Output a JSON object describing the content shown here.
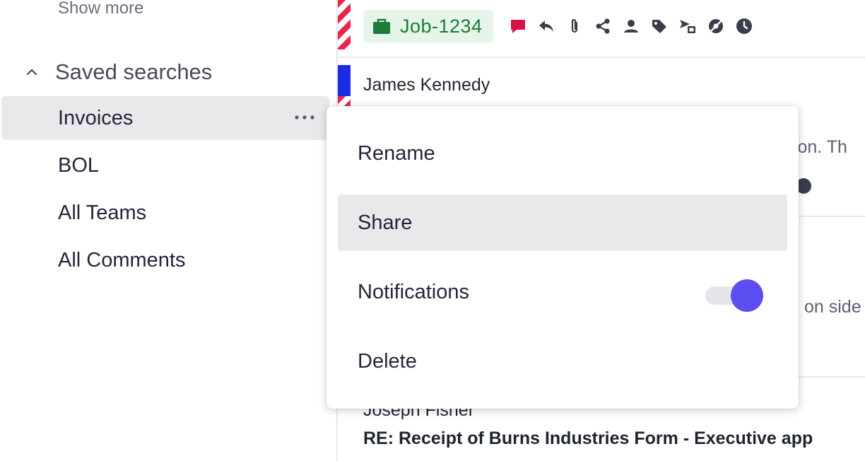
{
  "sidebar": {
    "show_more": "Show more",
    "saved_searches_label": "Saved searches",
    "items": [
      {
        "label": "Invoices"
      },
      {
        "label": "BOL"
      },
      {
        "label": "All Teams"
      },
      {
        "label": "All Comments"
      }
    ]
  },
  "context_menu": {
    "items": [
      {
        "label": "Rename"
      },
      {
        "label": "Share"
      },
      {
        "label": "Notifications",
        "toggle_on": true
      },
      {
        "label": "Delete"
      }
    ]
  },
  "thread": {
    "job_tag": "Job-1234",
    "toolbar_icons": [
      "comment-icon",
      "reply-icon",
      "attachment-icon",
      "share-icon",
      "user-icon",
      "tag-icon",
      "send-to-icon",
      "no-eye-icon",
      "clock-icon"
    ],
    "first_sender": "James Kennedy",
    "partial_text_1": "tion. Th",
    "partial_text_2": "on side",
    "second_sender": "Joseph Fisher",
    "subject": "RE: Receipt of Burns Industries Form - Executive app"
  },
  "colors": {
    "accent": "#5b4df0",
    "job_green": "#1f7a39",
    "job_bg": "#e6f5ea",
    "comment_red": "#d5144a",
    "stripe_red": "#e8264b",
    "stripe_blue": "#1d2de6",
    "hover_bg": "#e9e9ec"
  }
}
